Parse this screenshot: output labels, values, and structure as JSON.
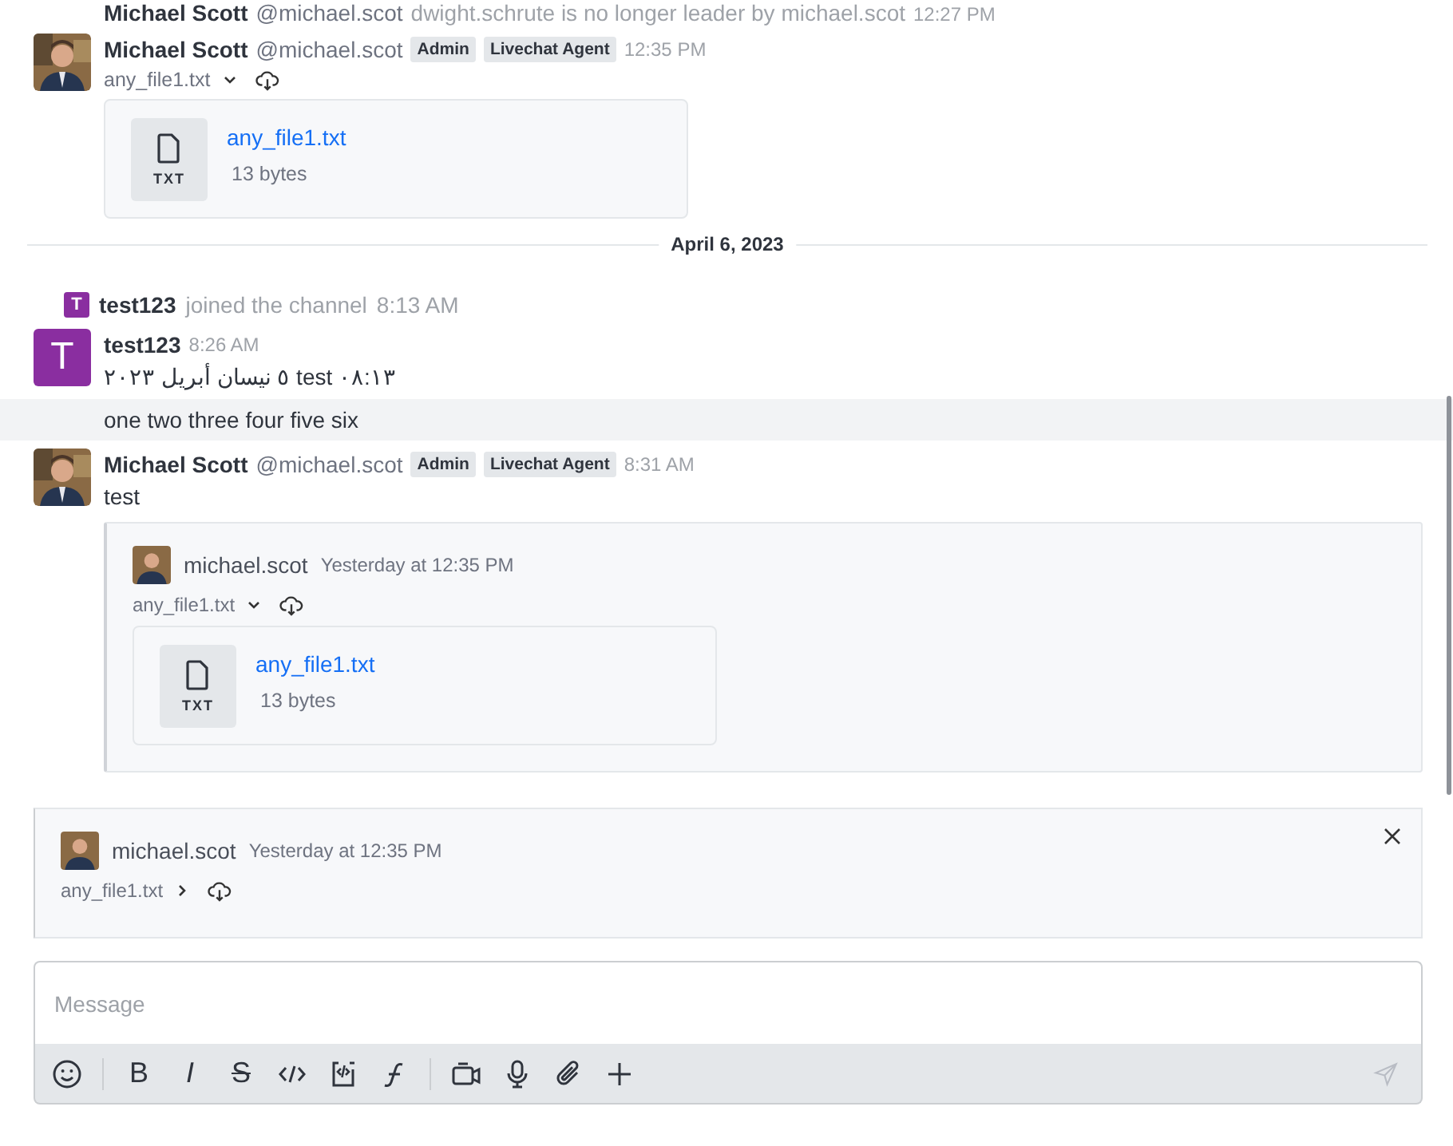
{
  "messages": [
    {
      "kind": "cut",
      "name": "Michael Scott",
      "username": "@michael.scot",
      "text": "dwight.schrute is no longer leader by michael.scot",
      "time": "12:27 PM"
    },
    {
      "kind": "user",
      "name": "Michael Scott",
      "username": "@michael.scot",
      "badges": [
        "Admin",
        "Livechat Agent"
      ],
      "time": "12:35 PM",
      "attachment": {
        "filename": "any_file1.txt",
        "expanded": true,
        "file": {
          "type": "TXT",
          "title": "any_file1.txt",
          "size": "13 bytes"
        }
      }
    },
    {
      "kind": "divider",
      "label": "April 6, 2023"
    },
    {
      "kind": "system",
      "avatar": {
        "kind": "letter",
        "letter": "T",
        "color": "#8a2ea0"
      },
      "name": "test123",
      "text": "joined the channel",
      "time": "8:13 AM"
    },
    {
      "kind": "user",
      "avatar": {
        "kind": "letter",
        "letter": "T",
        "color": "#8a2ea0"
      },
      "name": "test123",
      "time": "8:26 AM",
      "text": "٥ نيسان أبريل ٢٠٢٣ test ٠٨:١٣"
    },
    {
      "kind": "continuation",
      "highlighted": true,
      "text": "one two three four five six"
    },
    {
      "kind": "user",
      "name": "Michael Scott",
      "username": "@michael.scot",
      "badges": [
        "Admin",
        "Livechat Agent"
      ],
      "time": "8:31 AM",
      "text": "test",
      "quote": {
        "name": "michael.scot",
        "time": "Yesterday at 12:35 PM",
        "attachment": {
          "filename": "any_file1.txt",
          "expanded": true,
          "file": {
            "type": "TXT",
            "title": "any_file1.txt",
            "size": "13 bytes"
          }
        }
      }
    }
  ],
  "reply_preview": {
    "name": "michael.scot",
    "time": "Yesterday at 12:35 PM",
    "attachment": {
      "filename": "any_file1.txt",
      "expanded": false
    }
  },
  "composer": {
    "placeholder": "Message",
    "tools": [
      {
        "kind": "emoji"
      },
      {
        "kind": "sep"
      },
      {
        "kind": "bold",
        "glyph": "B"
      },
      {
        "kind": "italic",
        "glyph": "I"
      },
      {
        "kind": "strike",
        "glyph": "S"
      },
      {
        "kind": "code"
      },
      {
        "kind": "codeblock"
      },
      {
        "kind": "formula"
      },
      {
        "kind": "sep"
      },
      {
        "kind": "video"
      },
      {
        "kind": "mic"
      },
      {
        "kind": "clip"
      },
      {
        "kind": "plus"
      }
    ]
  }
}
